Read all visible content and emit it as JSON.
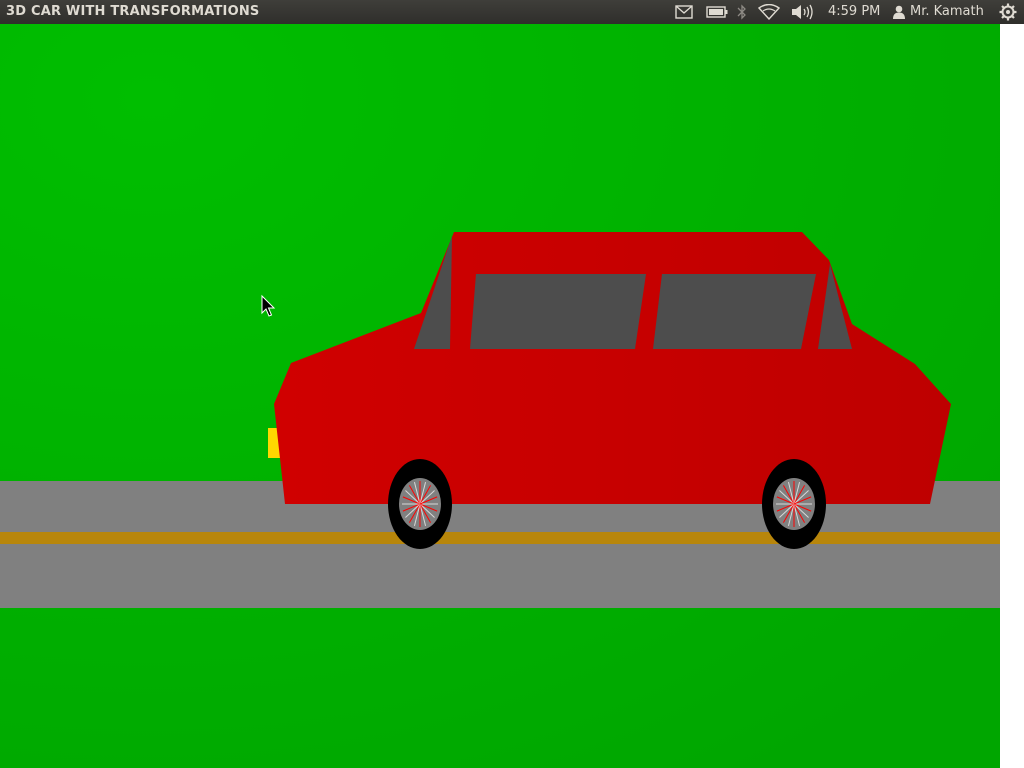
{
  "topbar": {
    "title": "3D CAR WITH TRANSFORMATIONS",
    "clock": "4:59 PM",
    "user": "Mr. Kamath",
    "indicators": [
      "mail-icon",
      "battery-icon",
      "bluetooth-icon",
      "wifi-icon",
      "volume-icon",
      "user-icon",
      "gear-icon"
    ]
  },
  "scene": {
    "colors": {
      "grass": "#00aa00",
      "road": "#808080",
      "road_stripe": "#b8860b",
      "car_body": "#cc0000",
      "windows": "#4d4d4d",
      "headlight": "#ffd700",
      "tire": "#000000",
      "rim": "#808080",
      "spokes": "#ff0000"
    }
  }
}
